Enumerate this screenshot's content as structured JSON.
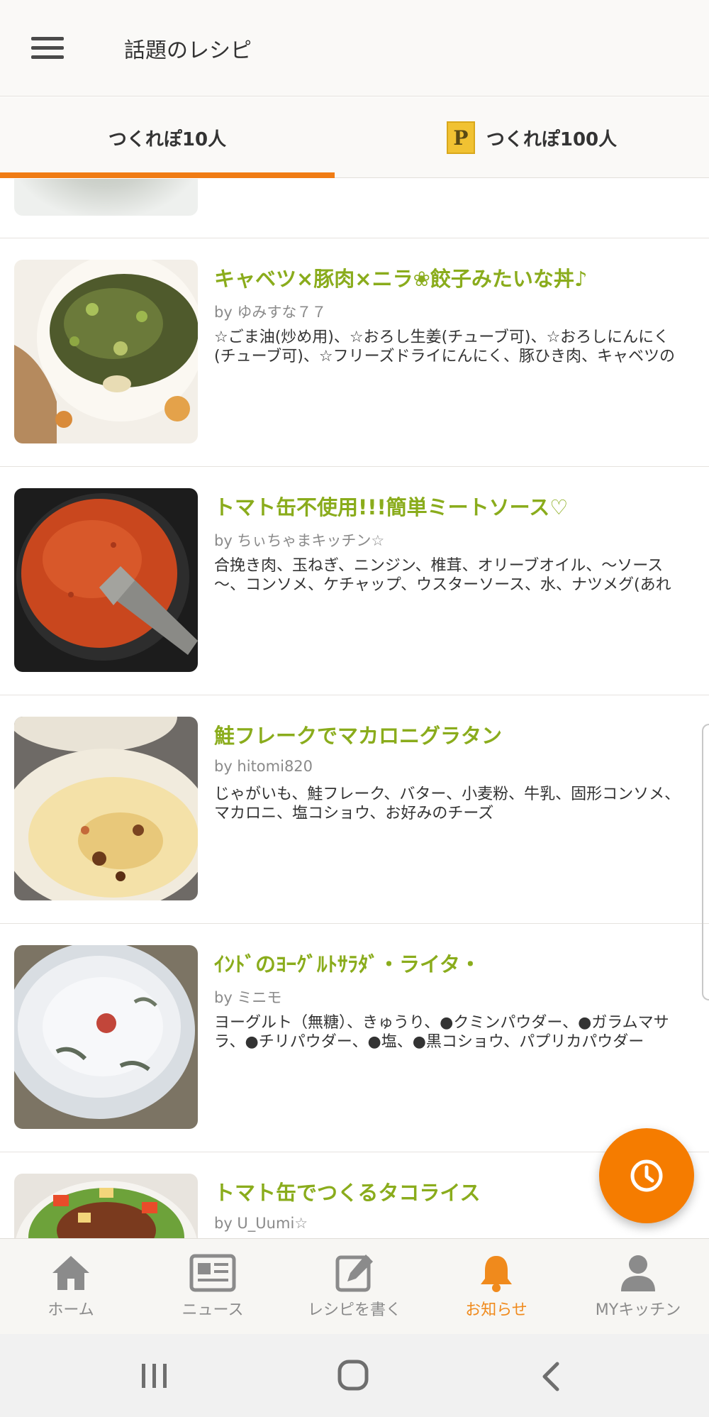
{
  "appbar": {
    "title": "話題のレシピ"
  },
  "tabs": [
    {
      "label": "つくれぽ10人"
    },
    {
      "label": "つくれぽ100人",
      "badge": "P"
    }
  ],
  "recipes": [
    {
      "title": "キャベツ×豚肉×ニラ❀餃子みたいな丼♪",
      "author": "by ゆみすな７７",
      "ingredients": "☆ごま油(炒め用)、☆おろし生姜(チューブ可)、☆おろしにんにく(チューブ可)、☆フリーズドライにんにく、豚ひき肉、キャベツの"
    },
    {
      "title": "トマト缶不使用!!!簡単ミートソース♡",
      "author": "by ちぃちゃまキッチン☆",
      "ingredients": "合挽き肉、玉ねぎ、ニンジン、椎茸、オリーブオイル、～ソース～、コンソメ、ケチャップ、ウスターソース、水、ナツメグ(あれ"
    },
    {
      "title": "鮭フレークでマカロニグラタン",
      "author": "by hitomi820",
      "ingredients": "じゃがいも、鮭フレーク、バター、小麦粉、牛乳、固形コンソメ、マカロニ、塩コショウ、お好みのチーズ"
    },
    {
      "title": "ｲﾝﾄﾞのﾖｰｸﾞﾙﾄｻﾗﾀﾞ・ライタ・",
      "author": "by ミニモ",
      "ingredients": "ヨーグルト（無糖）、きゅうり、●クミンパウダー、●ガラムマサラ、●チリパウダー、●塩、●黒コショウ、パプリカパウダー"
    },
    {
      "title": "トマト缶でつくるタコライス",
      "author": "by U_Uumi☆",
      "ingredients": ""
    }
  ],
  "bottom_nav": [
    {
      "label": "ホーム",
      "icon": "home-icon"
    },
    {
      "label": "ニュース",
      "icon": "news-icon"
    },
    {
      "label": "レシピを書く",
      "icon": "edit-icon"
    },
    {
      "label": "お知らせ",
      "icon": "bell-icon",
      "active": true
    },
    {
      "label": "MYキッチン",
      "icon": "person-icon"
    }
  ],
  "colors": {
    "accent": "#f07c14",
    "recipe_title": "#8aac1c",
    "fab": "#f57c00"
  }
}
